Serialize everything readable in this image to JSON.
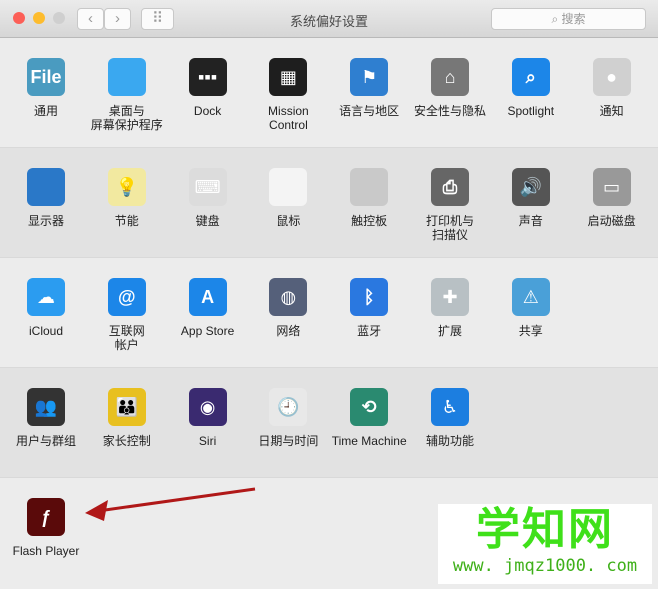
{
  "window": {
    "title": "系统偏好设置",
    "search_placeholder": "搜索",
    "back": "‹",
    "forward": "›",
    "grid": "⠿"
  },
  "rows": [
    {
      "bg": "#ececec",
      "items": [
        {
          "label": "通用",
          "icon": "general-icon",
          "color": "#4a9bc0",
          "glyph": "File"
        },
        {
          "label": "桌面与\n屏幕保护程序",
          "icon": "desktop-screensaver-icon",
          "color": "#3aa8f0",
          "glyph": ""
        },
        {
          "label": "Dock",
          "icon": "dock-icon",
          "color": "#222222",
          "glyph": "▪▪▪"
        },
        {
          "label": "Mission\nControl",
          "icon": "mission-control-icon",
          "color": "#1e1e1e",
          "glyph": "▦"
        },
        {
          "label": "语言与地区",
          "icon": "language-region-icon",
          "color": "#2f7fd0",
          "glyph": "⚑"
        },
        {
          "label": "安全性与隐私",
          "icon": "security-privacy-icon",
          "color": "#777777",
          "glyph": "⌂"
        },
        {
          "label": "Spotlight",
          "icon": "spotlight-icon",
          "color": "#1c86e8",
          "glyph": "⌕"
        },
        {
          "label": "通知",
          "icon": "notifications-icon",
          "color": "#d0d0d0",
          "glyph": "●"
        }
      ]
    },
    {
      "bg": "#e2e2e2",
      "items": [
        {
          "label": "显示器",
          "icon": "displays-icon",
          "color": "#2a78c8",
          "glyph": ""
        },
        {
          "label": "节能",
          "icon": "energy-saver-icon",
          "color": "#f2e9a0",
          "glyph": "💡"
        },
        {
          "label": "键盘",
          "icon": "keyboard-icon",
          "color": "#dcdcdc",
          "glyph": "⌨"
        },
        {
          "label": "鼠标",
          "icon": "mouse-icon",
          "color": "#f4f4f4",
          "glyph": ""
        },
        {
          "label": "触控板",
          "icon": "trackpad-icon",
          "color": "#c9c9c9",
          "glyph": ""
        },
        {
          "label": "打印机与\n扫描仪",
          "icon": "printer-scanner-icon",
          "color": "#666666",
          "glyph": "⎙"
        },
        {
          "label": "声音",
          "icon": "sound-icon",
          "color": "#555555",
          "glyph": "🔊"
        },
        {
          "label": "启动磁盘",
          "icon": "startup-disk-icon",
          "color": "#999999",
          "glyph": "▭"
        }
      ]
    },
    {
      "bg": "#ececec",
      "items": [
        {
          "label": "iCloud",
          "icon": "icloud-icon",
          "color": "#2b9cf0",
          "glyph": "☁"
        },
        {
          "label": "互联网\n帐户",
          "icon": "internet-accounts-icon",
          "color": "#1c86e8",
          "glyph": "@"
        },
        {
          "label": "App Store",
          "icon": "app-store-icon",
          "color": "#1c86e8",
          "glyph": "A"
        },
        {
          "label": "网络",
          "icon": "network-icon",
          "color": "#55607a",
          "glyph": "◍"
        },
        {
          "label": "蓝牙",
          "icon": "bluetooth-icon",
          "color": "#2a78e0",
          "glyph": "ᛒ"
        },
        {
          "label": "扩展",
          "icon": "extensions-icon",
          "color": "#b8c0c4",
          "glyph": "✚"
        },
        {
          "label": "共享",
          "icon": "sharing-icon",
          "color": "#4aa0d8",
          "glyph": "⚠"
        }
      ]
    },
    {
      "bg": "#e2e2e2",
      "items": [
        {
          "label": "用户与群组",
          "icon": "users-groups-icon",
          "color": "#333333",
          "glyph": "👥"
        },
        {
          "label": "家长控制",
          "icon": "parental-controls-icon",
          "color": "#e8c020",
          "glyph": "👪"
        },
        {
          "label": "Siri",
          "icon": "siri-icon",
          "color": "#3a2a70",
          "glyph": "◉"
        },
        {
          "label": "日期与时间",
          "icon": "date-time-icon",
          "color": "#e8e8e8",
          "glyph": "🕘"
        },
        {
          "label": "Time Machine",
          "icon": "time-machine-icon",
          "color": "#2a8a70",
          "glyph": "⟲"
        },
        {
          "label": "辅助功能",
          "icon": "accessibility-icon",
          "color": "#1c7ee0",
          "glyph": "♿"
        }
      ]
    },
    {
      "bg": "#ececec",
      "items": [
        {
          "label": "Flash Player",
          "icon": "flash-player-icon",
          "color": "#5a0a0a",
          "glyph": "ƒ"
        }
      ]
    }
  ],
  "watermark": {
    "title": "学知网",
    "url": "www. jmqz1000. com"
  }
}
